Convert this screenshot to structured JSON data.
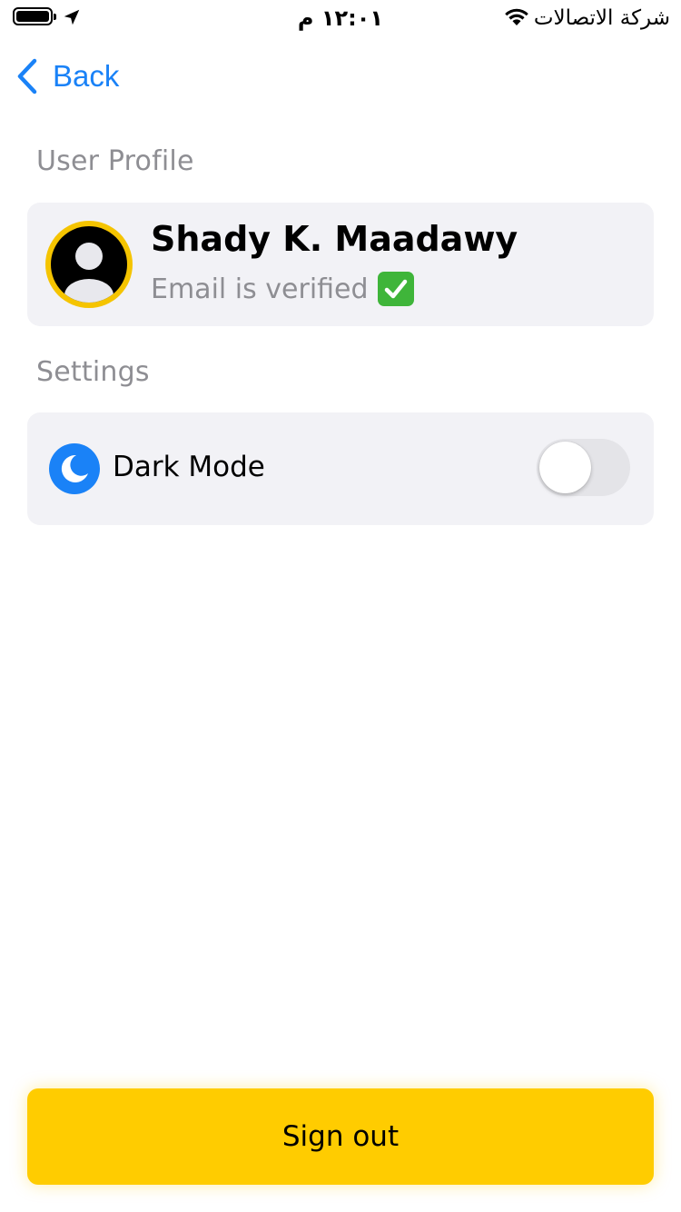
{
  "status_bar": {
    "time": "١٢:٠١ م",
    "carrier": "شركة الاتصالات",
    "battery_level_fraction": 1.0,
    "icons": [
      "battery-icon",
      "location-arrow-icon",
      "wifi-icon"
    ]
  },
  "nav": {
    "back_label": "Back"
  },
  "profile_section": {
    "title": "User Profile",
    "user": {
      "name": "Shady K. Maadawy",
      "email_status": "Email is verified",
      "verified_icon": "check-mark-button-icon",
      "avatar_icon": "person-icon"
    }
  },
  "settings_section": {
    "title": "Settings",
    "dark_mode": {
      "label": "Dark Mode",
      "icon": "moon-icon",
      "enabled": false
    }
  },
  "sign_out": {
    "label": "Sign out"
  },
  "colors": {
    "accent_blue": "#1a82f7",
    "brand_yellow": "#ffcc00",
    "card_background": "#f2f2f6",
    "secondary_text": "#8e8e93",
    "verified_green": "#3fb53a"
  }
}
